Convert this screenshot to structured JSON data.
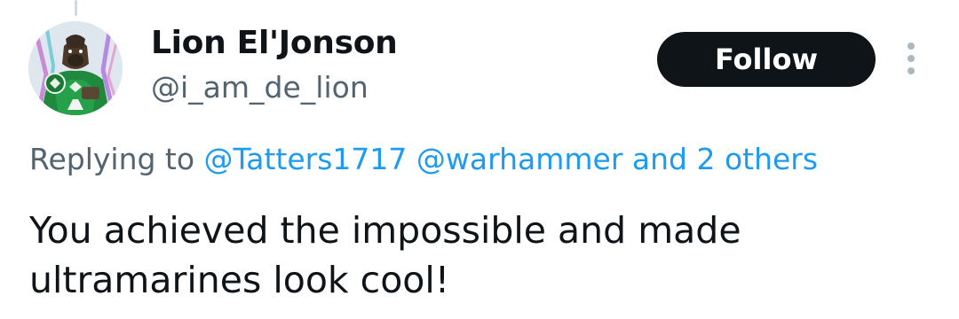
{
  "author": {
    "display_name": "Lion El'Jonson",
    "handle": "@i_am_de_lion",
    "avatar_icon": "lion-warrior-avatar"
  },
  "follow_button": {
    "label": "Follow"
  },
  "more_menu": {
    "icon": "more-vertical-icon"
  },
  "reply_context": {
    "prefix": "Replying to",
    "mentions": [
      "@Tatters1717",
      "@warhammer"
    ],
    "others": "and 2 others"
  },
  "tweet": {
    "text_lines": [
      "You achieved the impossible and made",
      "ultramarines look cool!"
    ]
  },
  "colors": {
    "link": "#1d9bf0",
    "secondary_text": "#536471",
    "button_bg": "#0f1419",
    "avatar_armor": "#1f8a3e"
  }
}
